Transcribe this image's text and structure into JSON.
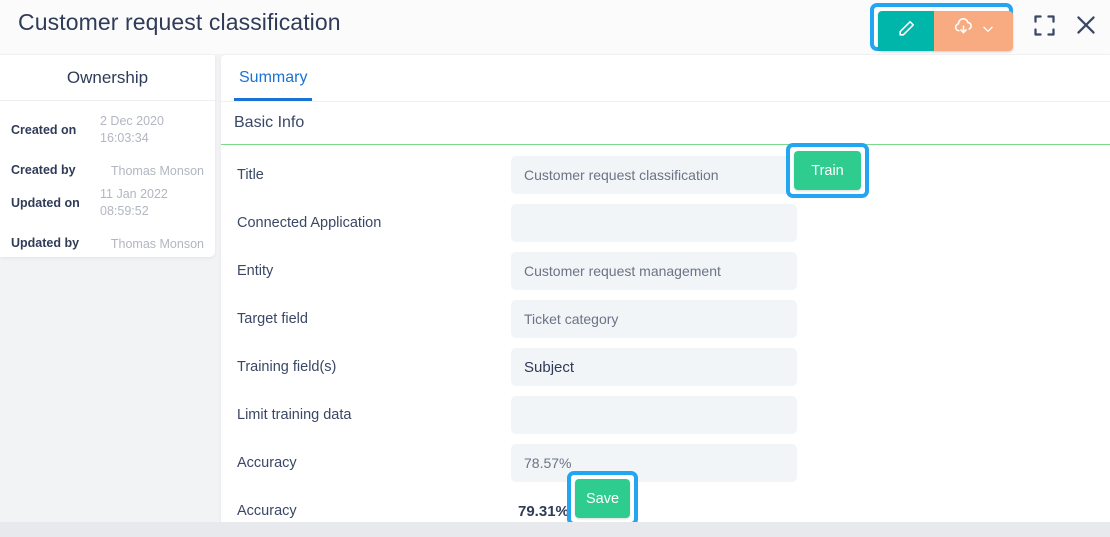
{
  "header": {
    "title": "Customer request classification",
    "edit_icon": "pencil-icon",
    "export_icon": "cloud-download-icon",
    "export_caret_icon": "chevron-down-icon",
    "expand_icon": "expand-icon",
    "close_icon": "close-icon"
  },
  "ownership": {
    "heading": "Ownership",
    "rows": [
      {
        "label": "Created on",
        "value": "2 Dec 2020\n16:03:34",
        "multiline": true
      },
      {
        "label": "Created by",
        "value": "Thomas Monson",
        "multiline": false
      },
      {
        "label": "Updated on",
        "value": "11 Jan 2022\n08:59:52",
        "multiline": true
      },
      {
        "label": "Updated by",
        "value": "Thomas Monson",
        "multiline": false
      }
    ]
  },
  "main": {
    "tabs": [
      {
        "label": "Summary",
        "active": true
      }
    ],
    "section_title": "Basic Info",
    "fields": [
      {
        "label": "Title",
        "value": "Customer request classification",
        "boxed": true,
        "strong": false
      },
      {
        "label": "Connected Application",
        "value": "",
        "boxed": true,
        "strong": false
      },
      {
        "label": "Entity",
        "value": "Customer request management",
        "boxed": true,
        "strong": false
      },
      {
        "label": "Target field",
        "value": "Ticket category",
        "boxed": true,
        "strong": false
      },
      {
        "label": "Training field(s)",
        "value": "Subject",
        "boxed": true,
        "strong": true
      },
      {
        "label": "Limit training data",
        "value": "",
        "boxed": true,
        "strong": false
      },
      {
        "label": "Accuracy",
        "value": "78.57%",
        "boxed": true,
        "strong": false
      },
      {
        "label": "Accuracy",
        "value": "79.31%",
        "boxed": false,
        "strong": true
      }
    ]
  },
  "buttons": {
    "train_label": "Train",
    "save_label": "Save"
  },
  "colors": {
    "accent_blue": "#1a73d4",
    "highlight_ring": "#22a6f2",
    "green_button": "#2ecc8f",
    "teal_edit": "#00b6ab",
    "peach_export": "#f8ab81",
    "section_underline_green": "#79d98c",
    "field_background": "#f1f5f8",
    "text_dark": "#2f3b57",
    "text_muted": "#b2b6c0"
  }
}
